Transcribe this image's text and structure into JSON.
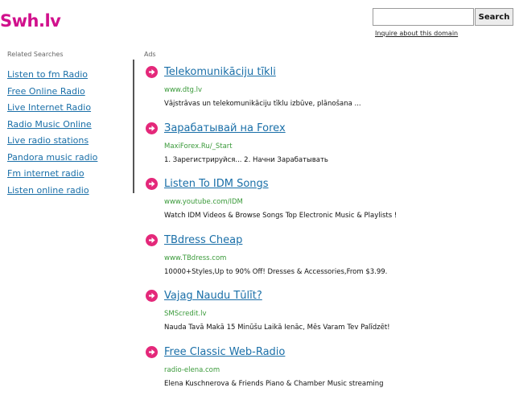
{
  "header": {
    "logo": "Swh.lv",
    "search_button": "Search",
    "search_placeholder": "",
    "inquire_link": "Inquire about this domain"
  },
  "related": {
    "title": "Related Searches",
    "items": [
      "Listen to fm Radio",
      "Free Online Radio",
      "Live Internet Radio",
      "Radio Music Online",
      "Live radio stations",
      "Pandora music radio",
      "Fm internet radio",
      "Listen online radio"
    ]
  },
  "ads": {
    "label": "Ads",
    "items": [
      {
        "title": "Telekomunikāciju tīkli",
        "url": "www.dtg.lv",
        "desc": "Vājstrāvas un telekomunikāciju tīklu izbūve, plānošana ..."
      },
      {
        "title": "Зарабатывай на Forex",
        "url": "MaxiForex.Ru/_Start",
        "desc": "1. Зарегистрируйся... 2. Начни Зарабатывать"
      },
      {
        "title": "Listen To IDM Songs",
        "url": "www.youtube.com/IDM",
        "desc": "Watch IDM Videos & Browse Songs Top Electronic Music & Playlists !"
      },
      {
        "title": "TBdress Cheap",
        "url": "www.TBdress.com",
        "desc": "10000+Styles,Up to 90% Off! Dresses & Accessories,From $3.99."
      },
      {
        "title": "Vajag Naudu Tūlīt?",
        "url": "SMScredit.lv",
        "desc": "Nauda Tavā Makā 15 Minūšu Laikā Ienāc, Mēs Varam Tev Palīdzēt!"
      },
      {
        "title": "Free Classic Web-Radio",
        "url": "radio-elena.com",
        "desc": "Elena Kuschnerova & Friends Piano & Chamber Music streaming"
      }
    ]
  },
  "colors": {
    "logo": "#d1108c",
    "link": "#1a6fa8",
    "url": "#3a9a3a",
    "bullet": "#e4287a"
  }
}
